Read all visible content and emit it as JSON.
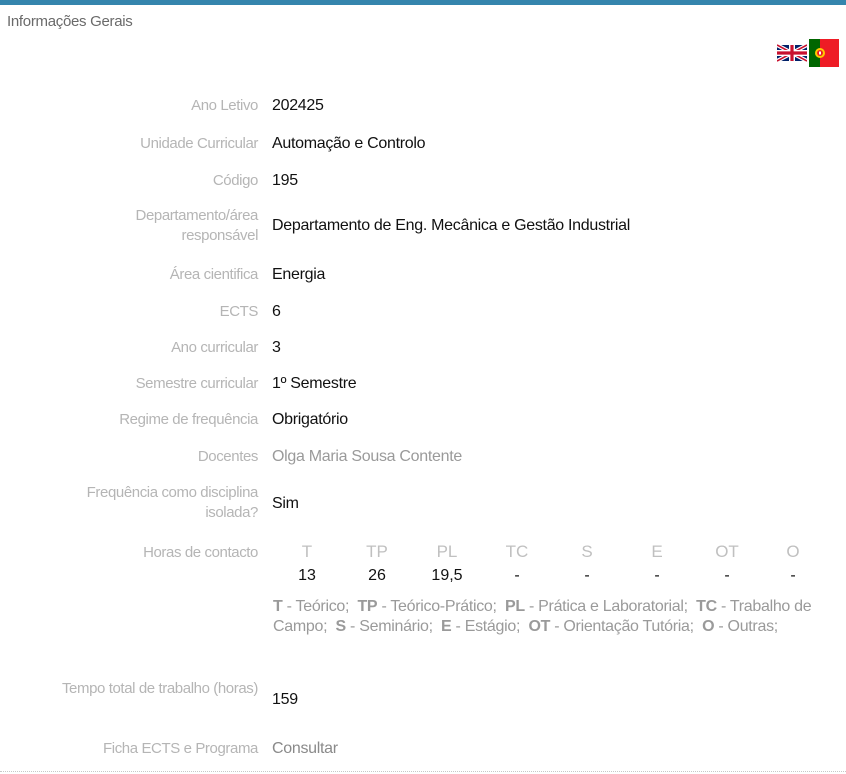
{
  "section_title": "Informações Gerais",
  "rows": [
    {
      "label": "Ano Letivo",
      "value": "202425"
    },
    {
      "label": "Unidade Curricular",
      "value": "Automação e Controlo"
    },
    {
      "label": "Código",
      "value": "195"
    },
    {
      "label": "Departamento/área responsável",
      "value": "Departamento de Eng. Mecânica e Gestão Industrial"
    },
    {
      "label": "Área cientifica",
      "value": "Energia"
    },
    {
      "label": "ECTS",
      "value": "6"
    },
    {
      "label": "Ano curricular",
      "value": "3"
    },
    {
      "label": "Semestre curricular",
      "value": "1º Semestre"
    },
    {
      "label": "Regime de frequência",
      "value": "Obrigatório"
    },
    {
      "label": "Docentes",
      "value": "Olga Maria Sousa Contente"
    },
    {
      "label": "Frequência como disciplina isolada?",
      "value": "Sim"
    },
    {
      "label": "Horas de contacto"
    },
    {
      "label": "Tempo total de trabalho (horas)",
      "value": "159"
    },
    {
      "label": "Ficha ECTS e Programa",
      "value": "Consultar"
    }
  ],
  "hours": {
    "headers": [
      "T",
      "TP",
      "PL",
      "TC",
      "S",
      "E",
      "OT",
      "O"
    ],
    "values": [
      "13",
      "26",
      "19,5",
      "-",
      "-",
      "-",
      "-",
      "-"
    ],
    "legend": [
      {
        "code": "T",
        "desc": "Teórico;"
      },
      {
        "code": "TP",
        "desc": "Teórico-Prático;"
      },
      {
        "code": "PL",
        "desc": "Prática e Laboratorial;"
      },
      {
        "code": "TC",
        "desc": "Trabalho de Campo;"
      },
      {
        "code": "S",
        "desc": "Seminário;"
      },
      {
        "code": "E",
        "desc": "Estágio;"
      },
      {
        "code": "OT",
        "desc": "Orientação Tutória;"
      },
      {
        "code": "O",
        "desc": "Outras;"
      }
    ]
  },
  "flags": [
    {
      "icon": "uk-flag-icon"
    },
    {
      "icon": "portugal-flag-icon"
    }
  ],
  "colors": {
    "accent": "#3585ad",
    "label": "#b5b5b5"
  }
}
